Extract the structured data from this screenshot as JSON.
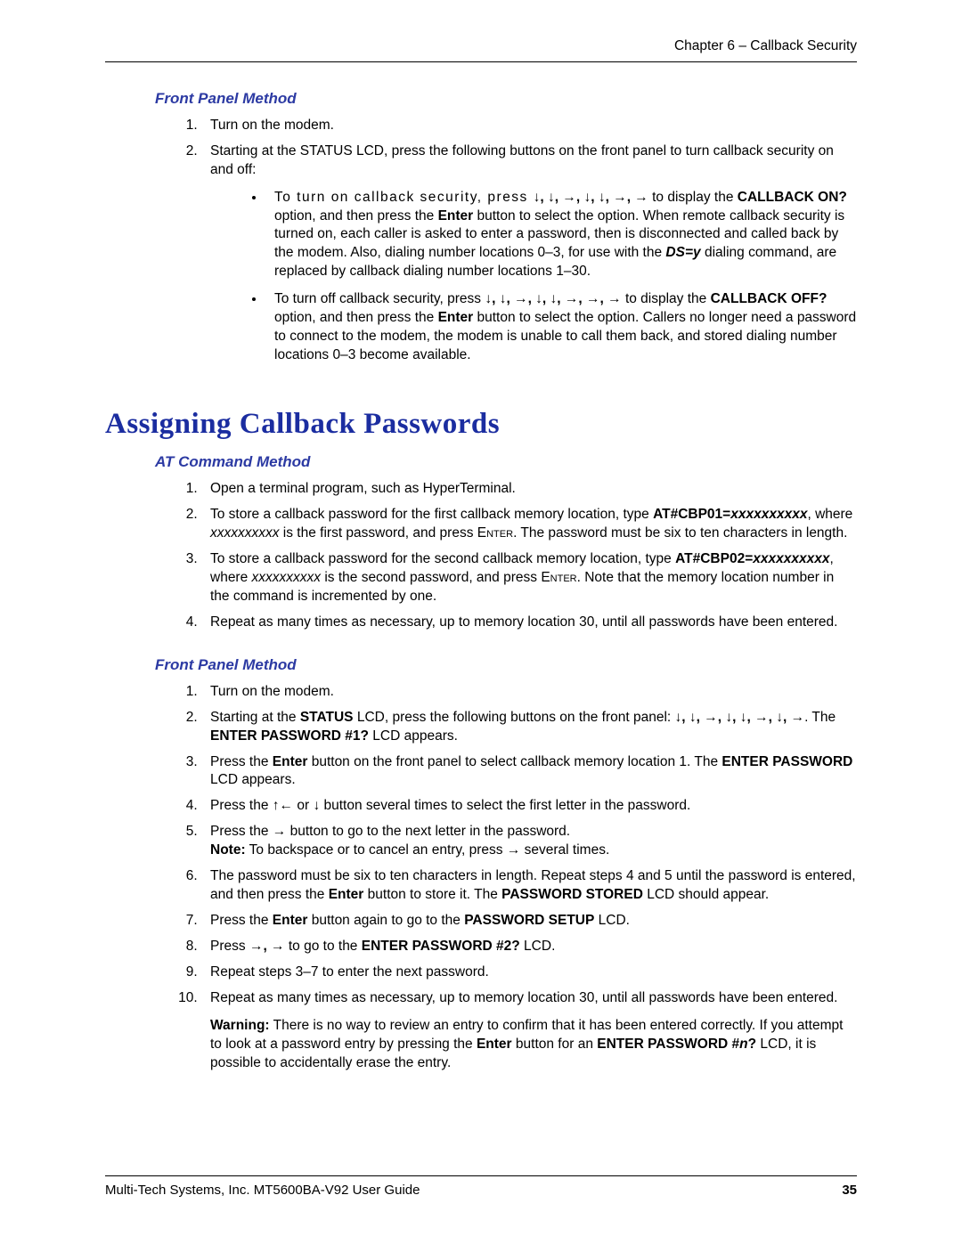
{
  "header": {
    "chapter": "Chapter 6 – Callback Security"
  },
  "sections": {
    "fpm1_title": "Front Panel Method",
    "fpm1": {
      "i1": "Turn on the modem.",
      "i2": "Starting at the STATUS LCD, press the following buttons on the front panel to turn callback security on and off:",
      "b1_lead": "To turn on callback security, press ",
      "b1_arrows": "↓, ↓, →, ↓, ↓, →, →",
      "b1_tail1": " to display the ",
      "b1_opt": "CALLBACK ON?",
      "b1_tail2": " option, and then press the ",
      "b1_enter": "Enter",
      "b1_tail3": " button to select the option. When remote callback security is turned on, each caller is asked to enter a password, then is disconnected and called back by the modem. Also, dialing number locations 0–3, for use with the ",
      "b1_ds": "DS=y",
      "b1_tail4": " dialing command, are replaced by callback dialing number locations 1–30.",
      "b2_lead": "To turn off callback security, press ",
      "b2_arrows": "↓, ↓, →, ↓, ↓, →, →, →",
      "b2_tail1": " to display the ",
      "b2_opt": "CALLBACK OFF?",
      "b2_tail2": " option, and then press the ",
      "b2_enter": "Enter",
      "b2_tail3": " button to select the option. Callers no longer need a password to connect to the modem, the modem is unable to call them back, and stored dialing number locations 0–3 become available."
    },
    "h_assign": "Assigning Callback Passwords",
    "atcm_title": "AT Command Method",
    "atcm": {
      "i1": "Open a terminal program, such as HyperTerminal.",
      "i2a": "To store a callback password for the first callback memory location, type ",
      "i2b": "AT#CBP01=",
      "i2c": "xxxxxxxxxx",
      "i2d": ", where ",
      "i2e": "xxxxxxxxxx",
      "i2f": " is the first password, and press ",
      "i2g": "Enter",
      "i2h": ". The password must be six to ten characters in length.",
      "i3a": "To store a callback password for the second callback memory location, type ",
      "i3b": "AT#CBP02=",
      "i3c": "xxxxxxxxxx",
      "i3d": ", where ",
      "i3e": "xxxxxxxxxx",
      "i3f": " is the second password, and press ",
      "i3g": "Enter",
      "i3h": ". Note that the memory location number in the command is incremented by one.",
      "i4": "Repeat as many times as necessary, up to memory location 30, until all passwords have been entered."
    },
    "fpm2_title": "Front Panel Method",
    "fpm2": {
      "i1": "Turn on the modem.",
      "i2a": "Starting at the ",
      "i2b": "STATUS",
      "i2c": " LCD, press the following buttons on the front panel: ",
      "i2arr": "↓, ↓, →, ↓, ↓, →, ↓, →",
      "i2d": ". The ",
      "i2e": "ENTER PASSWORD #1?",
      "i2f": " LCD appears.",
      "i3a": "Press the ",
      "i3b": "Enter",
      "i3c": " button on the front panel to select callback memory location 1. The ",
      "i3d": "ENTER PASSWORD",
      "i3e": " LCD appears.",
      "i4a": "Press the ",
      "i4b": "↑←",
      "i4c": " or ",
      "i4d": "↓",
      "i4e": " button several times to select the first letter in the password.",
      "i5a": "Press the ",
      "i5b": "→",
      "i5c": " button to go to the next letter in the password.",
      "i5note": "Note:",
      "i5d": " To backspace or to cancel an entry, press ",
      "i5e": "→",
      "i5f": " several times.",
      "i6a": "The password must be six to ten characters in length. Repeat steps 4 and 5 until the password is entered, and then press the ",
      "i6b": "Enter",
      "i6c": " button to store it. The ",
      "i6d": "PASSWORD STORED",
      "i6e": " LCD should appear.",
      "i7a": "Press the ",
      "i7b": "Enter",
      "i7c": " button again to go to the ",
      "i7d": "PASSWORD SETUP",
      "i7e": " LCD.",
      "i8a": "Press ",
      "i8b": "→, →",
      "i8c": " to go to the ",
      "i8d": "ENTER PASSWORD #2?",
      "i8e": " LCD.",
      "i9": "Repeat steps 3–7 to enter the next password.",
      "i10": "Repeat as many times as necessary, up to memory location 30, until all passwords have been entered.",
      "warn_label": "Warning:",
      "warn_a": " There is no way to review an entry to confirm that it has been entered correctly. If you attempt to look at a password entry by pressing the ",
      "warn_b": "Enter",
      "warn_c": " button for an ",
      "warn_d": "ENTER PASSWORD #",
      "warn_e": "n",
      "warn_f": "?",
      "warn_g": " LCD, it is possible to accidentally erase the entry."
    }
  },
  "footer": {
    "left": "Multi-Tech Systems, Inc. MT5600BA-V92 User Guide",
    "right": "35"
  }
}
